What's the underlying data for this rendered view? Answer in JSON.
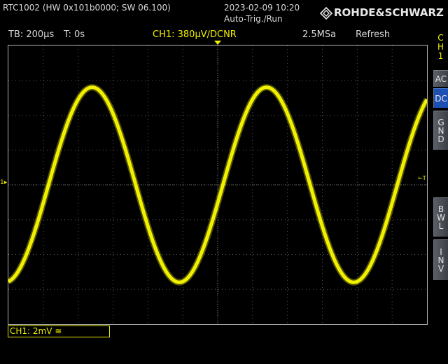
{
  "header": {
    "device_info": "RTC1002 (HW 0x101b0000; SW 06.100)",
    "datetime": "2023-02-09 10:20",
    "trigger_mode": "Auto-Trig./Run",
    "brand": "ROHDE&SCHWARZ"
  },
  "status_bar": {
    "timebase": "TB: 200µs",
    "trigger_time": "T: 0s",
    "channel_setting": "CH1: 380µV∕DCNR",
    "sample_rate": "2.5MSa",
    "refresh_mode": "Refresh"
  },
  "side_panel": {
    "channel_label": [
      "C",
      "H",
      "1"
    ],
    "buttons": [
      {
        "id": "ac",
        "letters": [
          "AC"
        ],
        "active": false
      },
      {
        "id": "dc",
        "letters": [
          "DC"
        ],
        "active": true
      },
      {
        "id": "gnd",
        "letters": [
          "G",
          "N",
          "D"
        ],
        "active": false
      },
      {
        "id": "bwl",
        "letters": [
          "B",
          "W",
          "L"
        ],
        "active": false
      },
      {
        "id": "inv",
        "letters": [
          "I",
          "N",
          "V"
        ],
        "active": false
      }
    ]
  },
  "screen": {
    "ground_marker": "1",
    "trigger_marker": "←T",
    "colors": {
      "trace": "#f0f000",
      "grid": "#5a5a5a",
      "background": "#000000"
    }
  },
  "chart_data": {
    "type": "line",
    "series": [
      {
        "name": "CH1",
        "color": "#f0f000"
      }
    ],
    "x_divisions": 12,
    "y_divisions": 8,
    "x_per_div": "200µs",
    "y_per_div": "2mV",
    "waveform": {
      "shape": "sine",
      "period_divisions": 5.0,
      "amplitude_divisions": 2.8,
      "peak_position_divisions": [
        2.4,
        7.4
      ],
      "offset_divisions": 0
    },
    "grid": true
  },
  "footer": {
    "channel_scale": "CH1: 2mV ≅"
  }
}
